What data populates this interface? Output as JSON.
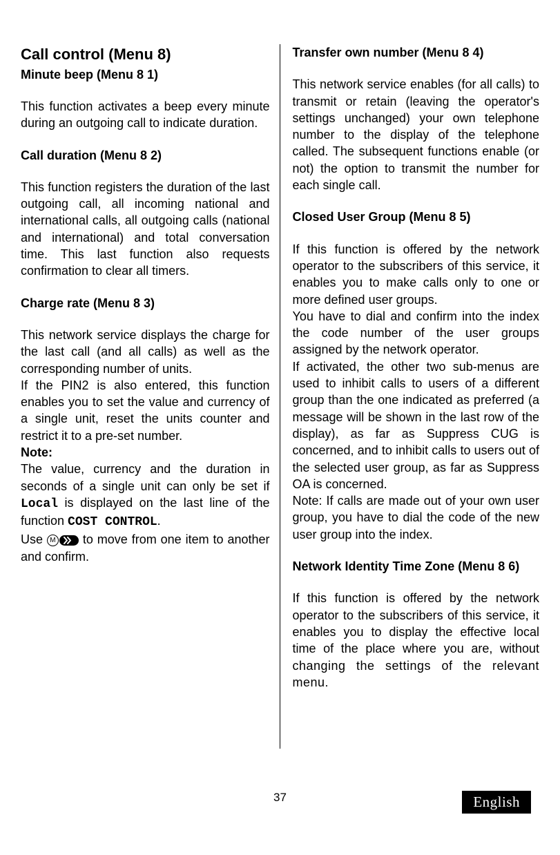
{
  "left": {
    "h1": "Call control (Menu 8)",
    "s1": {
      "h": "Minute beep (Menu 8 1)",
      "p": "This function activates a beep every mi­nute during an outgoing call to indicate duration."
    },
    "s2": {
      "h": "Call duration (Menu 8 2)",
      "p": "This function registers the duration of the last outgoing call, all incoming national and international calls, all outgoing calls (national and international) and total con­versation time. This last function also re­quests confirmation to clear all timers."
    },
    "s3": {
      "h": "Charge rate (Menu 8 3)",
      "p1": "This network service displays the charge for the last call (and all calls) as well as the corresponding number of units.",
      "p2": "If the PIN2 is also entered, this function enables you to set the value and currency of a single unit, reset the units counter and restrict it to a pre-set number.",
      "note_label": "Note:",
      "note_p_a": "The value, currency and the duration in seconds of a single unit can only be set if ",
      "note_local": "Local",
      "note_p_b": " is displayed on the last line of the function ",
      "note_cost": "COST CONTROL",
      "note_p_c": ".",
      "use_a": "Use ",
      "use_b": " to move from one item to anot­her and confirm."
    }
  },
  "right": {
    "s4": {
      "h": "Transfer own number (Menu 8 4)",
      "p": "This network service enables (for all calls) to transmit or retain (leaving the opera­tor's settings unchanged) your own tele­phone number to the display of the tele­phone called. The subsequent functions enable (or not) the option to transmit the number for each single call."
    },
    "s5": {
      "h": "Closed User Group (Menu 8 5)",
      "p1": "If this function is offered by the network operator to the subscribers of this service, it enables you to make calls only to one or more defined user groups.",
      "p2": "You have to dial and confirm into the in­dex the code number of the user groups assigned by the network operator.",
      "p3": "If activated, the other two sub-menus are used to inhibit calls to users of a different group than the one indicated as preferred (a message will be shown in the last row of the display), as far as Suppress CUG is concerned, and to inhibit calls to users out of the selected user group, as far as Suppress OA is concerned.",
      "p4": "Note: If calls are made out of your own user group, you have to dial the code of the new user group into the index."
    },
    "s6": {
      "h": "Network Identity Time Zone  (Menu 8 6)",
      "p1": "If this function is offered by the network operator to the subscribers of this service, it enables you to display the effective local time of the place where you are, without ",
      "p2": "changing the settings of the relevant menu."
    }
  },
  "footer": {
    "page": "37",
    "lang": "English"
  },
  "icons": {
    "m": "M"
  }
}
